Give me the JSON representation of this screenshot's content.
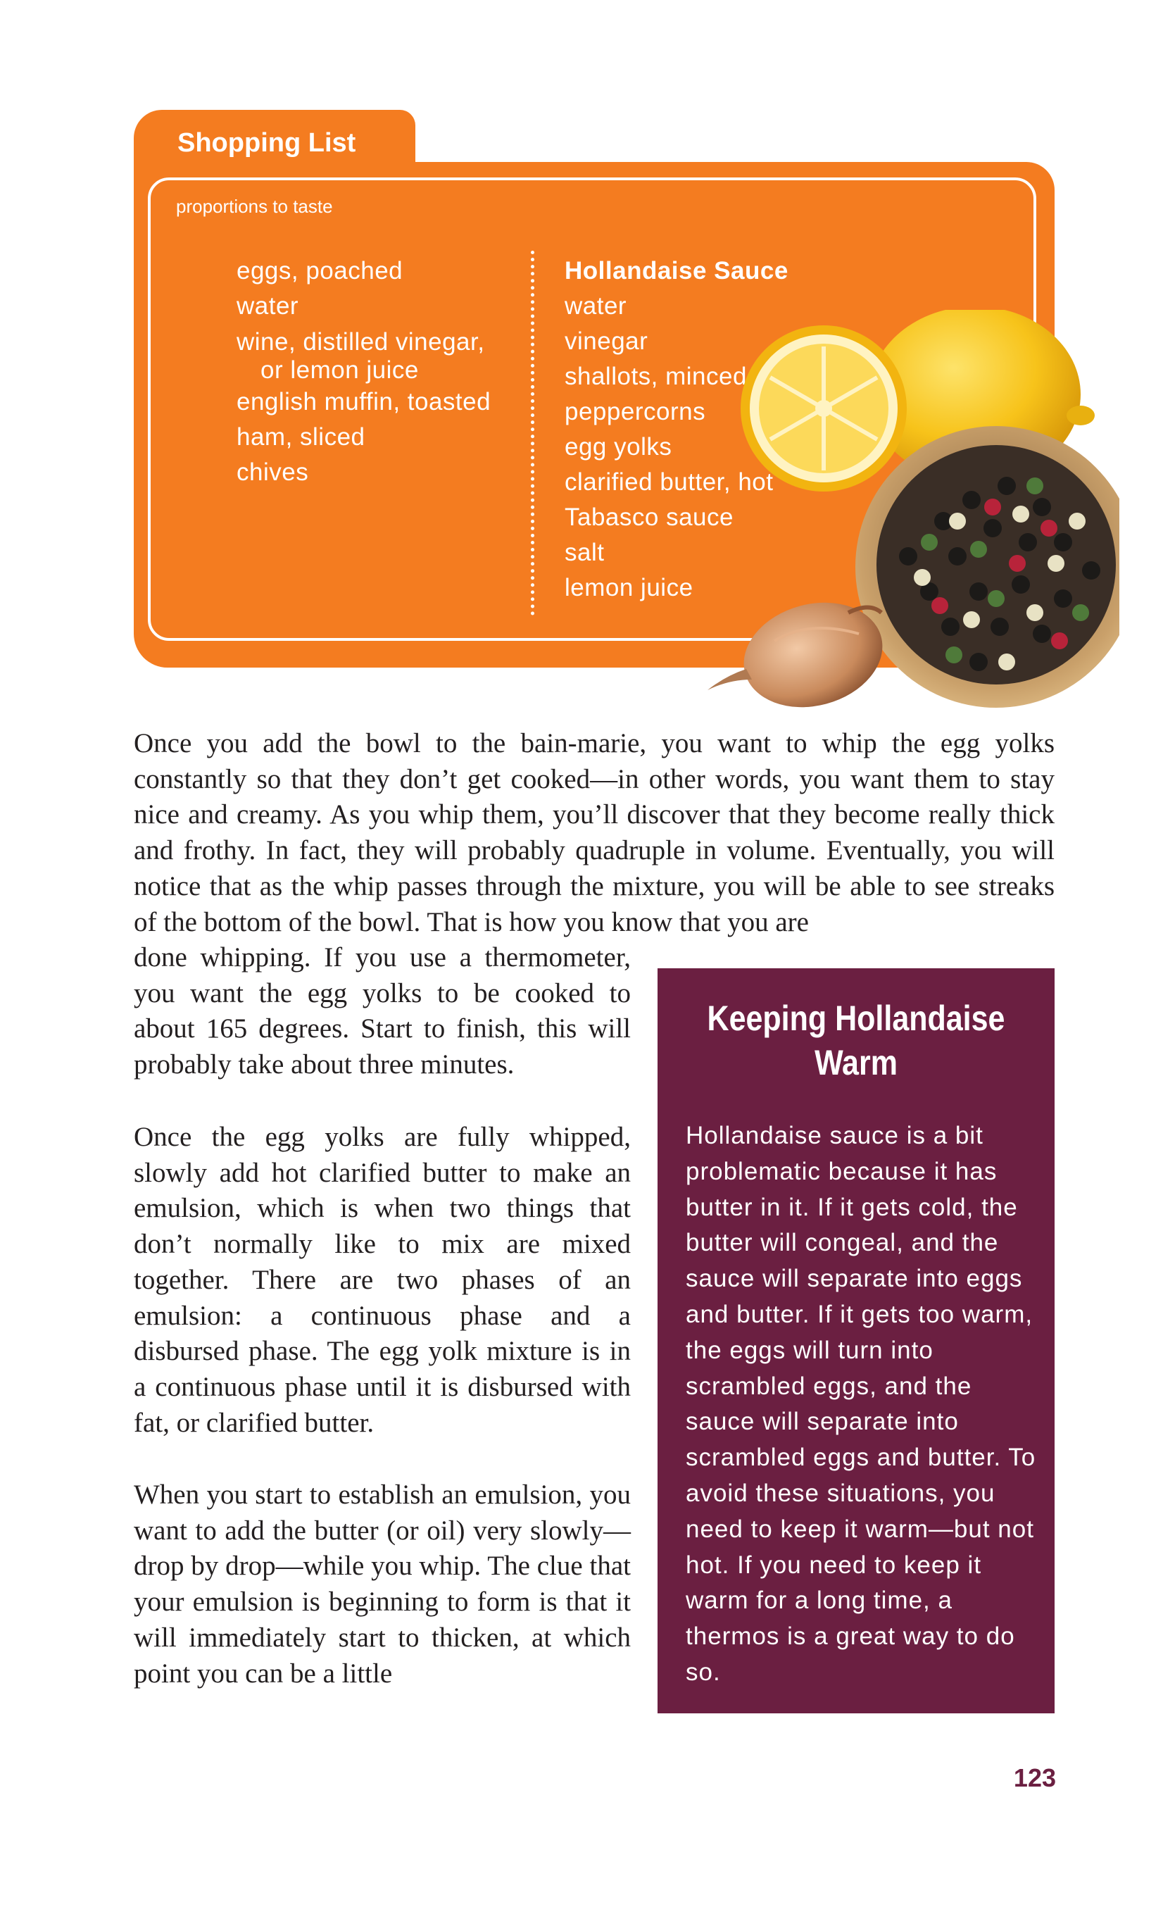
{
  "shopping_list": {
    "tab_title": "Shopping List",
    "note": "proportions to taste",
    "left_items": [
      "eggs, poached",
      "water",
      "wine, distilled vinegar,",
      "or lemon juice",
      "english muffin, toasted",
      "ham, sliced",
      "chives"
    ],
    "right_heading": "Hollandaise Sauce",
    "right_items": [
      "water",
      "vinegar",
      "shallots, minced",
      "peppercorns",
      "egg yolks",
      "clarified butter, hot",
      "Tabasco sauce",
      "salt",
      "lemon juice"
    ]
  },
  "body": {
    "p1": "Once you add the bowl to the bain-marie, you want to whip the egg yolks constantly so that they don’t get cooked—in other words, you want them to stay nice and creamy. As you whip them, you’ll discover that they become really thick and frothy. In fact, they will probably quadruple in volume. Eventually, you will notice that as the whip passes through the mixture, you will be able to see streaks of the bottom of the bowl. That is how you know that you are",
    "p1_cont": "done whipping. If you use a thermometer, you want the egg yolks to be cooked to about 165 degrees. Start to finish, this will probably take about three minutes.",
    "p2": "Once the egg yolks are fully whipped, slowly add hot clarified butter to make an emulsion, which is when two things that don’t normally like to mix are mixed together. There are two phases of an emulsion: a continuous phase and a disbursed phase. The egg yolk mixture is in a continuous phase until it is disbursed with fat, or clarified butter.",
    "p3": "When you start to establish an emulsion, you want to add the butter (or oil) very slowly—drop by drop—while you whip. The clue that your emulsion is beginning to form is that it will immediately start to thicken, at which point you can be a little"
  },
  "sidebar": {
    "title": "Keeping Hollandaise Warm",
    "text": "Hollandaise sauce is a bit problematic because it has butter in it. If it gets cold, the butter will congeal, and the sauce will separate into eggs and butter. If it gets too warm, the eggs will turn into scrambled eggs, and the sauce will separate into scrambled eggs and butter. To avoid these situations, you need to keep it warm—but not hot. If you need to keep it warm for a long time, a thermos is a great way to do so."
  },
  "page_number": "123",
  "colors": {
    "orange": "#f47c20",
    "maroon": "#6b1f41",
    "lemon": "#f7c31a",
    "peppercorn_bowl": "#c9a06a",
    "shallot": "#c98a5c"
  },
  "illustration_icons": [
    "lemon-icon",
    "peppercorn-bowl-icon",
    "shallot-icon"
  ]
}
